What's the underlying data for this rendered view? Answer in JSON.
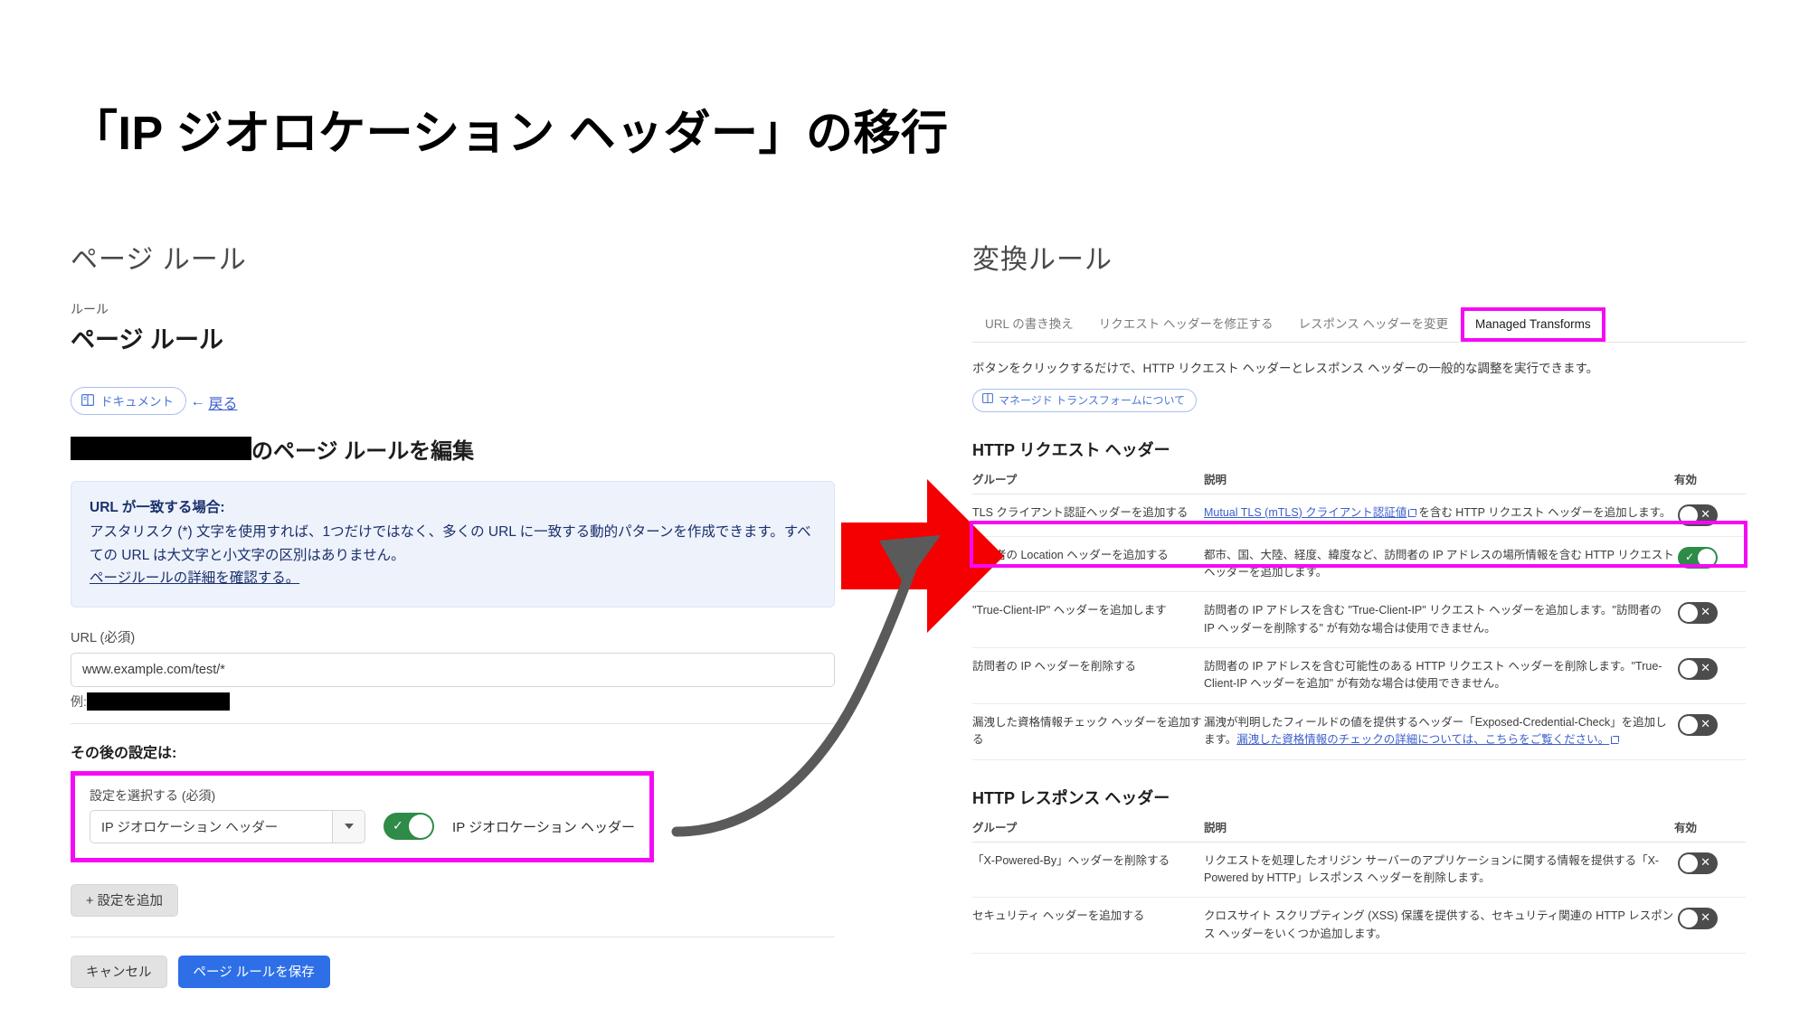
{
  "slide": {
    "title": "「IP ジオロケーション ヘッダー」の移行"
  },
  "colors": {
    "highlight_magenta": "#f609f6",
    "red_arrow": "#f40000",
    "gray_arrow": "#5a5a5a",
    "toggle_on_green": "#2e8b48",
    "toggle_off_gray": "#4c4c4c",
    "primary_blue": "#2e6fe8",
    "link_blue": "#3b5ecc"
  },
  "left": {
    "panel_heading": "ページ ルール",
    "breadcrumb_label": "ルール",
    "section_title": "ページ ルール",
    "doc_pill": {
      "label": "ドキュメント",
      "icon": "book-icon"
    },
    "back_link": {
      "arrow": "←",
      "label": "戻る"
    },
    "edit_heading_suffix": "のページ ルールを編集",
    "callout": {
      "heading": "URL が一致する場合:",
      "body": "アスタリスク (*) 文字を使用すれば、1つだけではなく、多くの URL に一致する動的パターンを作成できます。すべての URL は大文字と小文字の区別はありません。",
      "link": "ページルールの詳細を確認する。"
    },
    "url_field": {
      "label": "URL (必須)",
      "value": "www.example.com/test/*",
      "placeholder": ""
    },
    "example_prefix": "例:",
    "after_label": "その後の設定は:",
    "setting": {
      "label": "設定を選択する (必須)",
      "selected_option": "IP ジオロケーション ヘッダー",
      "toggle_label": "IP ジオロケーション ヘッダー",
      "toggle_state": "on"
    },
    "add_setting_button": "+ 設定を追加",
    "cancel_button": "キャンセル",
    "save_button": "ページ ルールを保存"
  },
  "right": {
    "panel_heading": "変換ルール",
    "tabs": [
      {
        "label": "URL の書き換え",
        "active": false
      },
      {
        "label": "リクエスト ヘッダーを修正する",
        "active": false
      },
      {
        "label": "レスポンス ヘッダーを変更",
        "active": false
      },
      {
        "label": "Managed Transforms",
        "active": true
      }
    ],
    "description": "ボタンをクリックするだけで、HTTP リクエスト ヘッダーとレスポンス ヘッダーの一般的な調整を実行できます。",
    "doc_pill": {
      "label": "マネージド トランスフォームについて",
      "icon": "book-icon"
    },
    "request_table": {
      "title": "HTTP リクエスト ヘッダー",
      "columns": [
        "グループ",
        "説明",
        "有効"
      ],
      "rows": [
        {
          "group": "TLS クライアント認証ヘッダーを追加する",
          "desc_link": "Mutual TLS (mTLS) クライアント認証値",
          "desc_rest": "を含む HTTP リクエスト ヘッダーを追加します。",
          "enabled": "off"
        },
        {
          "group": "訪問者の Location ヘッダーを追加する",
          "desc_link": "",
          "desc_rest": "都市、国、大陸、経度、緯度など、訪問者の IP アドレスの場所情報を含む HTTP リクエスト ヘッダーを追加します。",
          "enabled": "on"
        },
        {
          "group": "\"True-Client-IP\" ヘッダーを追加します",
          "desc_link": "",
          "desc_rest": "訪問者の IP アドレスを含む \"True-Client-IP\" リクエスト ヘッダーを追加します。\"訪問者の IP ヘッダーを削除する\" が有効な場合は使用できません。",
          "enabled": "off"
        },
        {
          "group": "訪問者の IP ヘッダーを削除する",
          "desc_link": "",
          "desc_rest": "訪問者の IP アドレスを含む可能性のある HTTP リクエスト ヘッダーを削除します。\"True-Client-IP ヘッダーを追加\" が有効な場合は使用できません。",
          "enabled": "off"
        },
        {
          "group": "漏洩した資格情報チェック ヘッダーを追加する",
          "desc_link": "漏洩した資格情報のチェックの詳細については、こちらをご覧ください。",
          "desc_rest": "漏洩が判明したフィールドの値を提供するヘッダー「Exposed-Credential-Check」を追加します。",
          "enabled": "off"
        }
      ]
    },
    "response_table": {
      "title": "HTTP レスポンス ヘッダー",
      "columns": [
        "グループ",
        "説明",
        "有効"
      ],
      "rows": [
        {
          "group": "「X-Powered-By」ヘッダーを削除する",
          "desc_rest": "リクエストを処理したオリジン サーバーのアプリケーションに関する情報を提供する「X-Powered by HTTP」レスポンス ヘッダーを削除します。",
          "enabled": "off"
        },
        {
          "group": "セキュリティ ヘッダーを追加する",
          "desc_rest": "クロスサイト スクリプティング (XSS) 保護を提供する、セキュリティ関連の HTTP レスポンス ヘッダーをいくつか追加します。",
          "enabled": "off"
        }
      ]
    }
  }
}
